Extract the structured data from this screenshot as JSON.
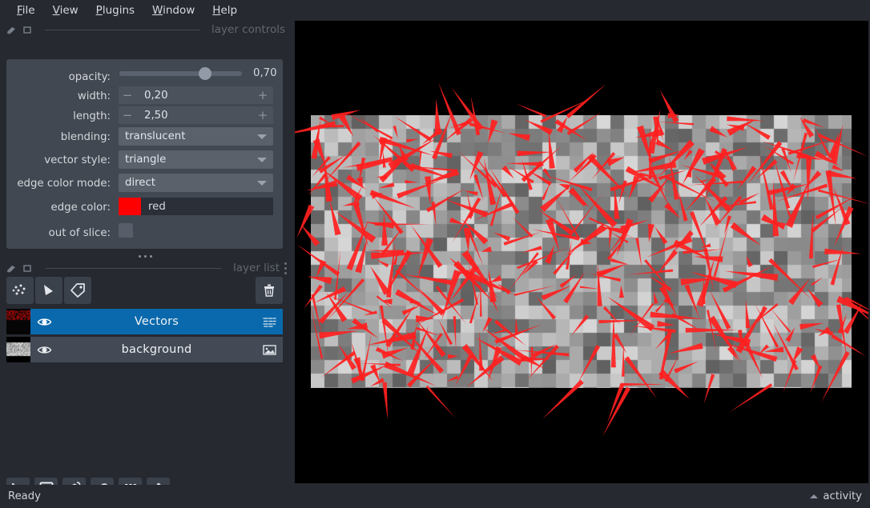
{
  "window": {
    "background_color": "#262930",
    "panel_color": "#414851"
  },
  "menubar": {
    "items": [
      {
        "label": "File",
        "mnemonic": "F"
      },
      {
        "label": "View",
        "mnemonic": "V"
      },
      {
        "label": "Plugins",
        "mnemonic": "P"
      },
      {
        "label": "Window",
        "mnemonic": "W"
      },
      {
        "label": "Help",
        "mnemonic": "H"
      }
    ]
  },
  "layer_controls": {
    "title": "layer controls",
    "rows": {
      "opacity": {
        "label": "opacity:",
        "value": "0,70",
        "fraction": 0.7
      },
      "width": {
        "label": "width:",
        "value": "0,20",
        "minus": "−",
        "plus": "+"
      },
      "length": {
        "label": "length:",
        "value": "2,50",
        "minus": "−",
        "plus": "+"
      },
      "blending": {
        "label": "blending:",
        "value": "translucent"
      },
      "vector_style": {
        "label": "vector style:",
        "value": "triangle"
      },
      "edge_color_mode": {
        "label": "edge color mode:",
        "value": "direct"
      },
      "edge_color": {
        "label": "edge color:",
        "value": "red",
        "swatch": "#ff0000"
      },
      "out_of_slice": {
        "label": "out of slice:",
        "checked": false
      }
    }
  },
  "layer_list": {
    "title": "layer list",
    "toolbar": [
      {
        "name": "new-points-layer",
        "tooltip": "New points layer"
      },
      {
        "name": "new-shapes-layer",
        "tooltip": "New shapes layer"
      },
      {
        "name": "new-labels-layer",
        "tooltip": "New labels layer"
      },
      {
        "name": "delete-layer",
        "tooltip": "Delete selected layers"
      }
    ],
    "layers": [
      {
        "name": "Vectors",
        "selected": true,
        "visible": true,
        "type": "vectors"
      },
      {
        "name": "background",
        "selected": false,
        "visible": true,
        "type": "image"
      }
    ]
  },
  "viewer_buttons": [
    {
      "name": "console-button",
      "icon": "console-icon"
    },
    {
      "name": "ndisplay-button",
      "icon": "square-icon"
    },
    {
      "name": "cube-button",
      "icon": "cube-icon"
    },
    {
      "name": "roll-dims-button",
      "icon": "roll-icon"
    },
    {
      "name": "grid-view-button",
      "icon": "grid-icon"
    },
    {
      "name": "reset-view-button",
      "icon": "home-icon"
    }
  ],
  "statusbar": {
    "status": "Ready",
    "activity": "activity"
  },
  "canvas": {
    "background_color": "#000000",
    "image_layer": {
      "description": "random grayscale noise block texture",
      "block_size": 17,
      "gray_min": 96,
      "gray_max": 215
    },
    "vectors_layer": {
      "color": "#ff1f1f",
      "style": "triangle",
      "count": 440,
      "length_scale": 2.5,
      "width": 0.2
    }
  }
}
